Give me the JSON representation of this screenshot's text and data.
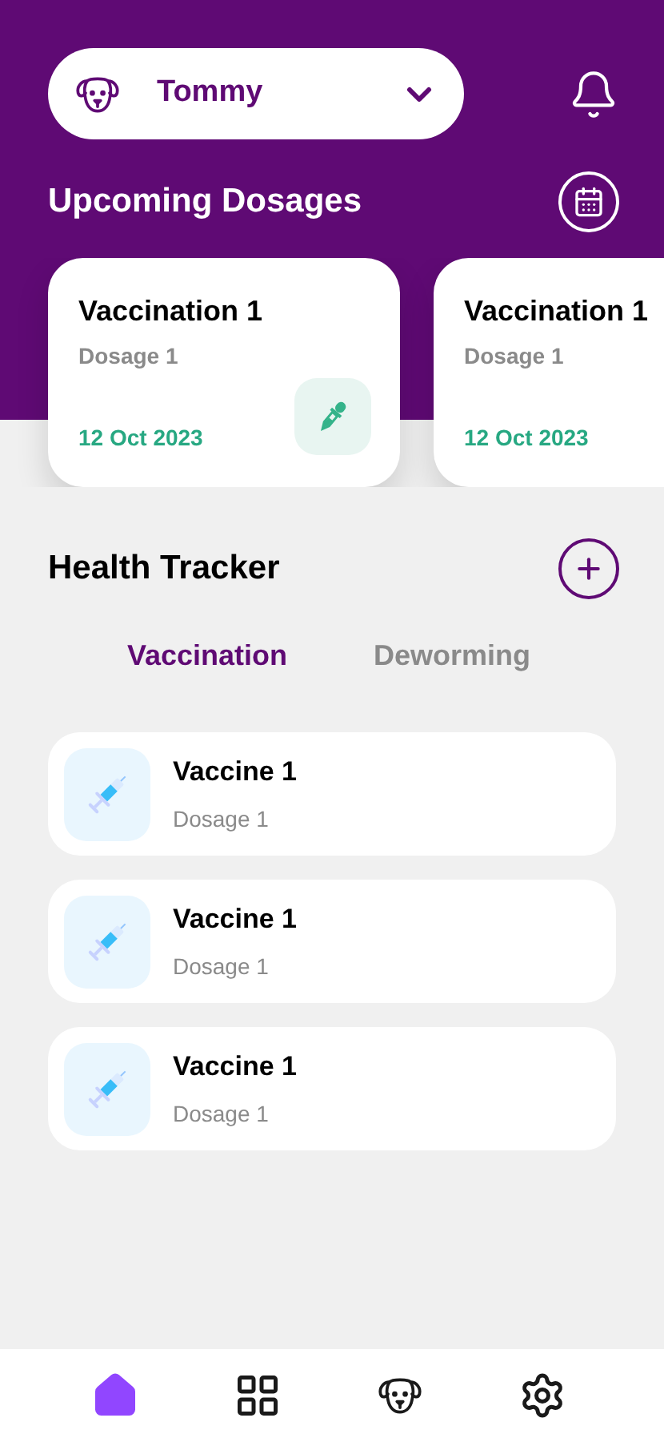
{
  "pet_selector": {
    "name": "Tommy"
  },
  "upcoming": {
    "title": "Upcoming Dosages",
    "cards": [
      {
        "title": "Vaccination 1",
        "subtitle": "Dosage 1",
        "date": "12 Oct 2023"
      },
      {
        "title": "Vaccination 1",
        "subtitle": "Dosage 1",
        "date": "12 Oct 2023"
      }
    ]
  },
  "health_tracker": {
    "title": "Health Tracker",
    "tabs": [
      {
        "label": "Vaccination",
        "selected": true
      },
      {
        "label": "Deworming",
        "selected": false
      }
    ],
    "items": [
      {
        "title": "Vaccine 1",
        "subtitle": "Dosage 1"
      },
      {
        "title": "Vaccine 1",
        "subtitle": "Dosage 1"
      },
      {
        "title": "Vaccine 1",
        "subtitle": "Dosage 1"
      }
    ]
  },
  "bottom_nav": [
    {
      "kind": "home",
      "selected": true
    },
    {
      "kind": "grid",
      "selected": false
    },
    {
      "kind": "pet",
      "selected": false
    },
    {
      "kind": "settings",
      "selected": false
    }
  ]
}
